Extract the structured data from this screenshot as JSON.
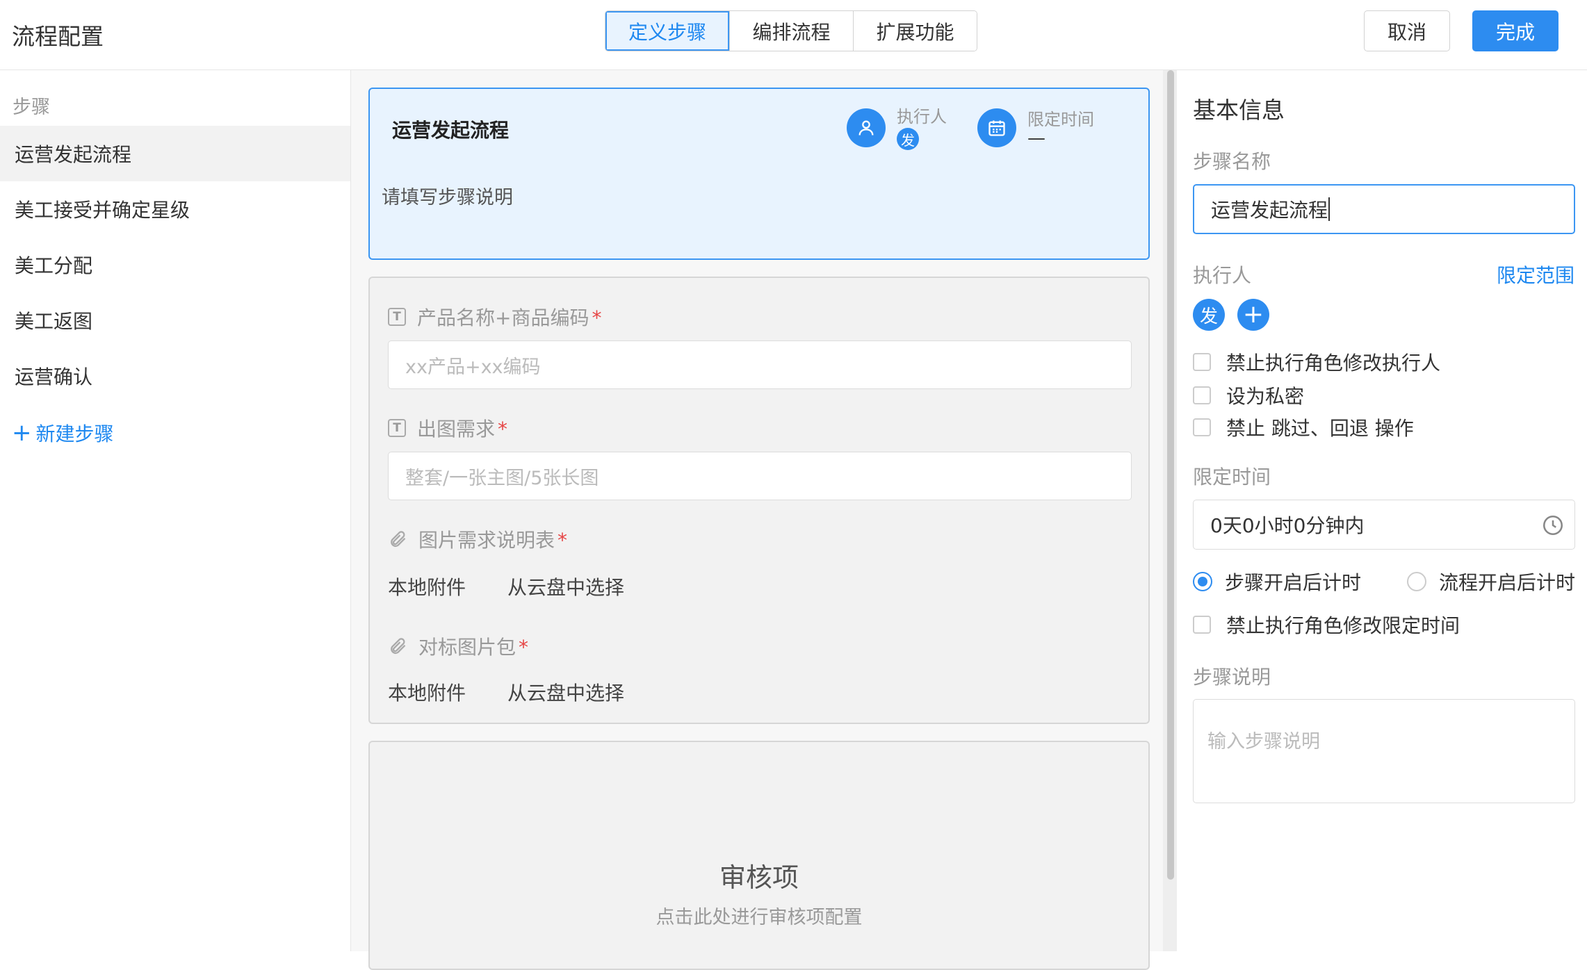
{
  "header": {
    "title": "流程配置",
    "tabs": [
      {
        "label": "定义步骤",
        "active": true
      },
      {
        "label": "编排流程",
        "active": false
      },
      {
        "label": "扩展功能",
        "active": false
      }
    ],
    "cancel_label": "取消",
    "done_label": "完成"
  },
  "sidebar": {
    "heading": "步骤",
    "steps": [
      {
        "label": "运营发起流程",
        "active": true
      },
      {
        "label": "美工接受并确定星级",
        "active": false
      },
      {
        "label": "美工分配",
        "active": false
      },
      {
        "label": "美工返图",
        "active": false
      },
      {
        "label": "运营确认",
        "active": false
      }
    ],
    "new_step_icon": "+",
    "new_step_label": "新建步骤"
  },
  "canvas": {
    "step_card": {
      "title": "运营发起流程",
      "executor_label": "执行人",
      "executor_avatar": "发",
      "time_label": "限定时间",
      "time_value": "—",
      "description": "请填写步骤说明"
    },
    "fields": [
      {
        "icon": "text-field-icon",
        "label": "产品名称+商品编码",
        "required_mark": "*",
        "placeholder": "xx产品+xx编码"
      },
      {
        "icon": "text-field-icon",
        "label": "出图需求",
        "required_mark": "*",
        "placeholder": "整套/一张主图/5张长图"
      },
      {
        "icon": "paperclip-icon",
        "label": "图片需求说明表",
        "required_mark": "*",
        "options": [
          "本地附件",
          "从云盘中选择"
        ]
      },
      {
        "icon": "paperclip-icon",
        "label": "对标图片包",
        "required_mark": "*",
        "options": [
          "本地附件",
          "从云盘中选择"
        ]
      }
    ],
    "text_icon_glyph": "T",
    "audit": {
      "title": "审核项",
      "subtitle": "点击此处进行审核项配置"
    }
  },
  "panel": {
    "title": "基本信息",
    "step_name_label": "步骤名称",
    "step_name_value": "运营发起流程",
    "executor_label": "执行人",
    "scope_link": "限定范围",
    "executor_avatar": "发",
    "add_executor_icon": "+",
    "executor_checks": [
      {
        "label": "禁止执行角色修改执行人",
        "checked": false
      },
      {
        "label": "设为私密",
        "checked": false
      },
      {
        "label": "禁止 跳过、回退 操作",
        "checked": false
      }
    ],
    "time_label": "限定时间",
    "time_value": "0天0小时0分钟内",
    "timer_options": [
      {
        "label": "步骤开启后计时",
        "selected": true
      },
      {
        "label": "流程开启后计时",
        "selected": false
      }
    ],
    "time_check": {
      "label": "禁止执行角色修改限定时间",
      "checked": false
    },
    "desc_label": "步骤说明",
    "desc_placeholder": "输入步骤说明"
  },
  "colors": {
    "accent": "#2d8cf0",
    "active_bg": "#e8f3fe",
    "required": "#e64545"
  }
}
